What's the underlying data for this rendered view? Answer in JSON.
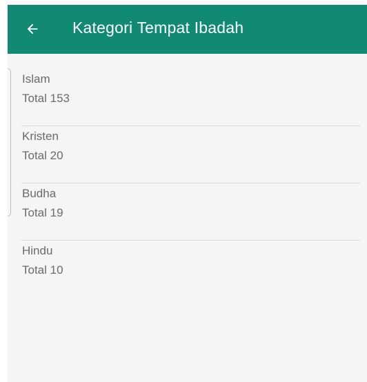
{
  "appbar": {
    "title": "Kategori Tempat Ibadah",
    "background_color": "#108a73",
    "back_icon": "arrow-left-icon"
  },
  "list": {
    "items": [
      {
        "name": "Islam",
        "total": "Total 153"
      },
      {
        "name": "Kristen",
        "total": "Total 20"
      },
      {
        "name": "Budha",
        "total": "Total 19"
      },
      {
        "name": "Hindu",
        "total": "Total 10"
      }
    ]
  }
}
